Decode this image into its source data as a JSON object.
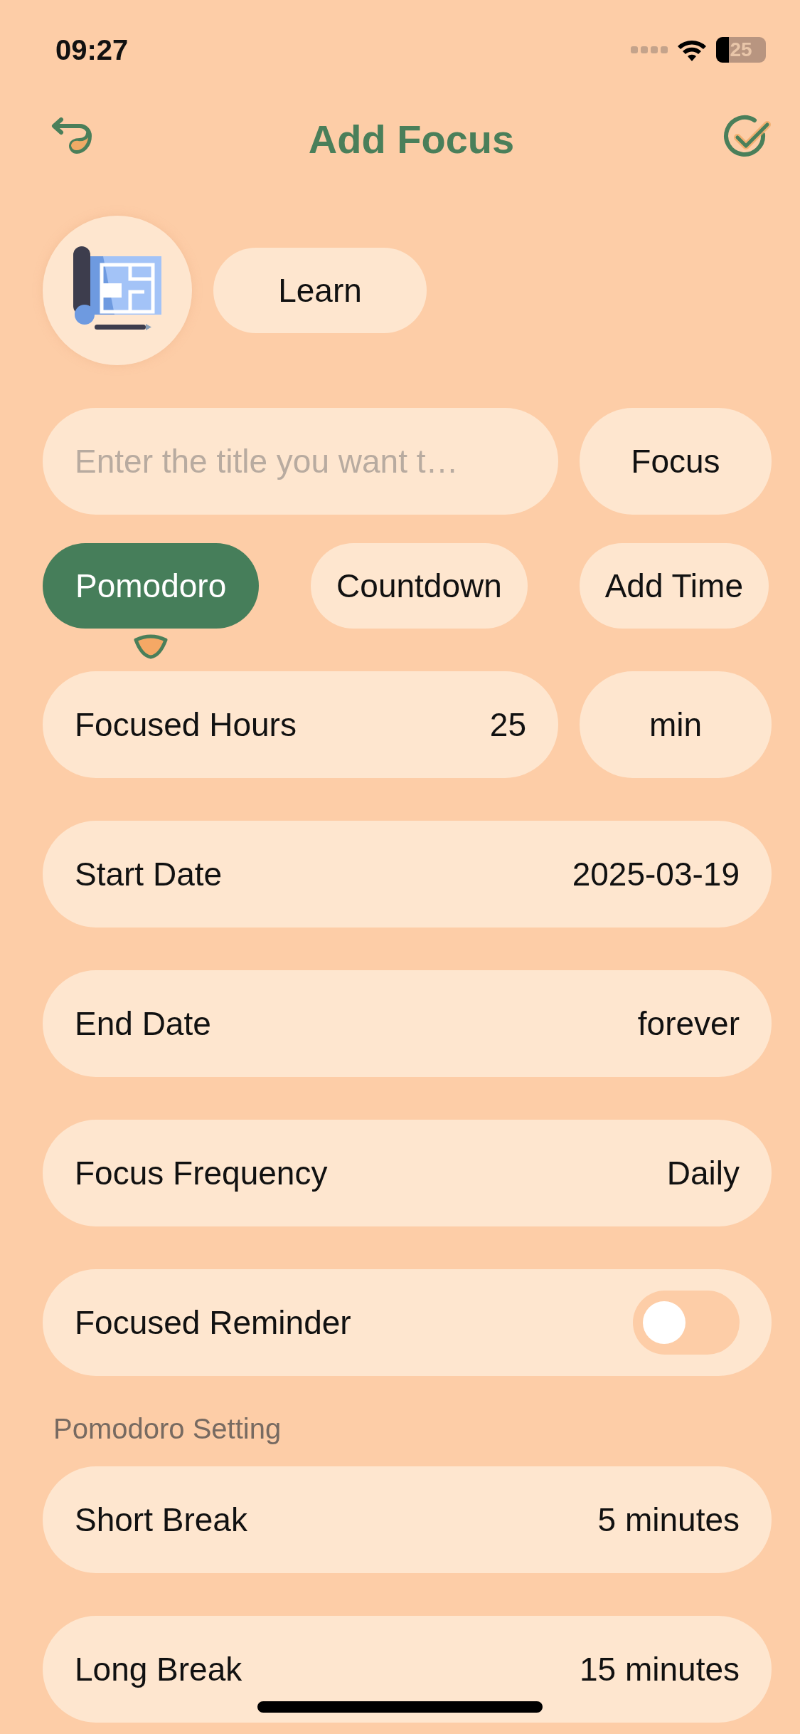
{
  "status_bar": {
    "time": "09:27",
    "battery": "25"
  },
  "header": {
    "title": "Add Focus"
  },
  "category": {
    "label": "Learn"
  },
  "title_field": {
    "placeholder": "Enter the title you want t…",
    "type_label": "Focus"
  },
  "tabs": [
    {
      "label": "Pomodoro",
      "selected": true
    },
    {
      "label": "Countdown",
      "selected": false
    },
    {
      "label": "Add Time",
      "selected": false
    }
  ],
  "rows": [
    {
      "kind": "value",
      "label": "Focused Hours",
      "value": "25",
      "unit": "min"
    },
    {
      "kind": "value",
      "label": "Start Date",
      "value": "2025-03-19"
    },
    {
      "kind": "value",
      "label": "End Date",
      "value": "forever"
    },
    {
      "kind": "value",
      "label": "Focus Frequency",
      "value": "Daily"
    },
    {
      "kind": "toggle",
      "label": "Focused Reminder",
      "on": false
    },
    {
      "kind": "section",
      "label": "Pomodoro Setting"
    },
    {
      "kind": "value",
      "label": "Short Break",
      "value": "5 minutes"
    },
    {
      "kind": "value",
      "label": "Long Break",
      "value": "15 minutes"
    }
  ]
}
